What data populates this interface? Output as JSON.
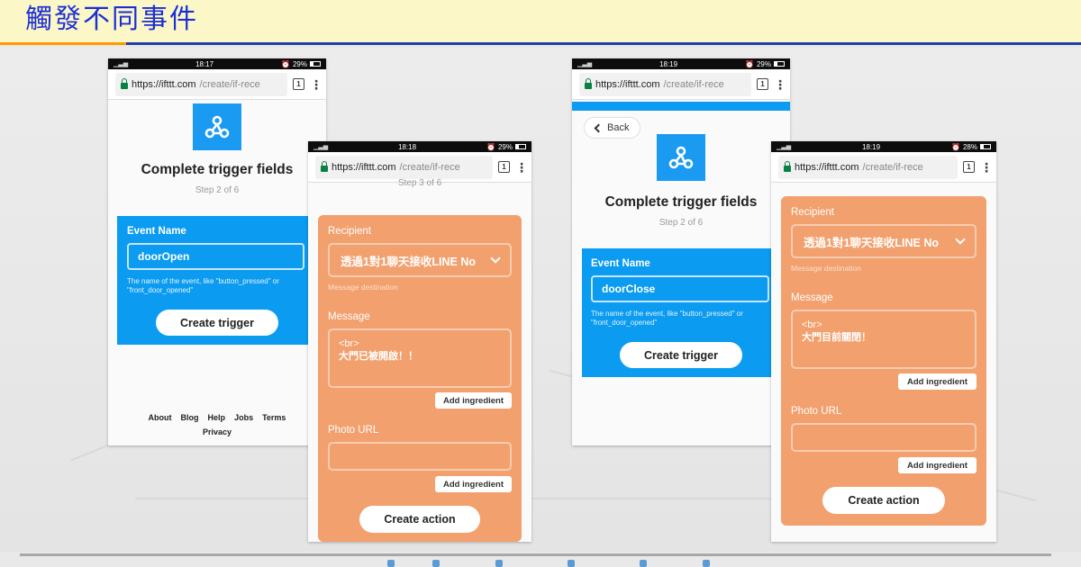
{
  "slide": {
    "title": "觸發不同事件"
  },
  "status": {
    "signal": "▁▃▅",
    "battery_icon": "battery-icon",
    "alarm_icon": "alarm-icon"
  },
  "phone1": {
    "time": "18:17",
    "battery": "29%",
    "url_host": "https://ifttt.com",
    "url_path": "/create/if-rece",
    "tabs": "1",
    "heading": "Complete trigger fields",
    "step": "Step 2 of 6",
    "event_label": "Event Name",
    "event_value": "doorOpen",
    "helper": "The name of the event, like \"button_pressed\" or \"front_door_opened\"",
    "create_trigger": "Create trigger",
    "footer": [
      "About",
      "Blog",
      "Help",
      "Jobs",
      "Terms",
      "Privacy"
    ]
  },
  "phone2": {
    "time": "18:18",
    "battery": "29%",
    "url_host": "https://ifttt.com",
    "url_path": "/create/if-rece",
    "tabs": "1",
    "step_partial": "Step 3 of 6",
    "recipient_label": "Recipient",
    "recipient_value": "透過1對1聊天接收LINE No",
    "recipient_hint": "Message destination",
    "message_label": "Message",
    "message_line1": "<br>",
    "message_line2": "大門已被開啟！！",
    "add_ingredient": "Add ingredient",
    "photo_label": "Photo URL",
    "create_action": "Create action"
  },
  "phone3": {
    "time": "18:19",
    "battery": "29%",
    "url_host": "https://ifttt.com",
    "url_path": "/create/if-rece",
    "tabs": "1",
    "back": "Back",
    "heading": "Complete trigger fields",
    "step": "Step 2 of 6",
    "event_label": "Event Name",
    "event_value": "doorClose",
    "helper": "The name of the event, like \"button_pressed\" or \"front_door_opened\"",
    "create_trigger": "Create trigger"
  },
  "phone4": {
    "time": "18:19",
    "battery": "28%",
    "url_host": "https://ifttt.com",
    "url_path": "/create/if-rece",
    "tabs": "1",
    "recipient_label": "Recipient",
    "recipient_value": "透過1對1聊天接收LINE No",
    "recipient_hint": "Message destination",
    "message_label": "Message",
    "message_line1": "<br>",
    "message_line2": "大門目前關閉！",
    "add_ingredient": "Add ingredient",
    "photo_label": "Photo URL",
    "create_action": "Create action"
  },
  "colors": {
    "ifttt_blue": "#0b9bf0",
    "webhook_orange": "#f2a06e",
    "title_blue": "#1b2fd6"
  }
}
